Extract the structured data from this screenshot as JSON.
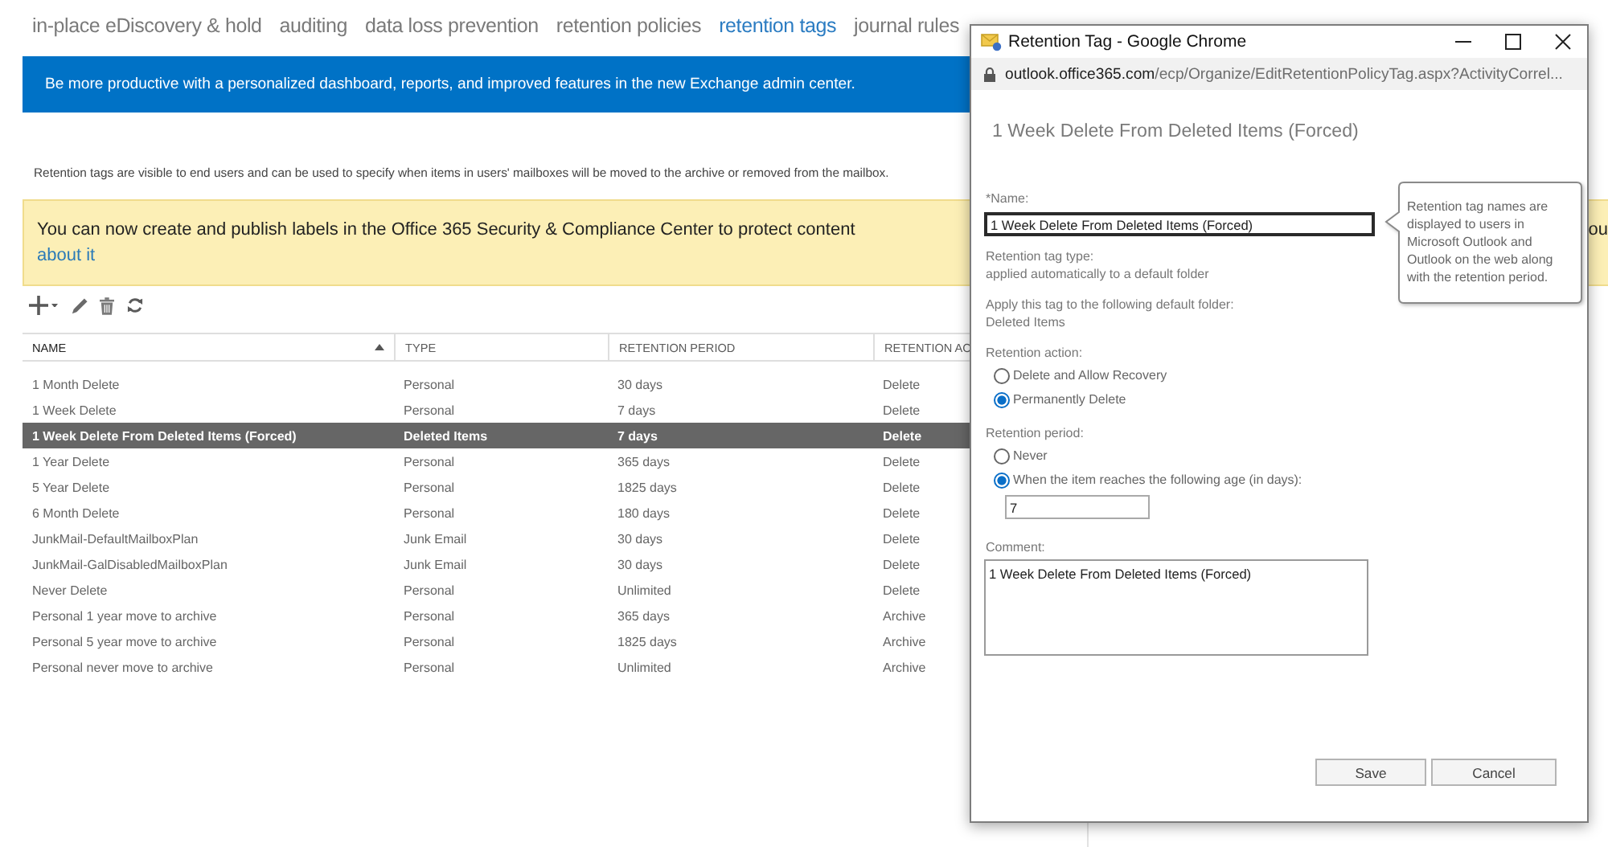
{
  "nav_tabs": [
    {
      "label": "in-place eDiscovery & hold",
      "selected": false
    },
    {
      "label": "auditing",
      "selected": false
    },
    {
      "label": "data loss prevention",
      "selected": false
    },
    {
      "label": "retention policies",
      "selected": false
    },
    {
      "label": "retention tags",
      "selected": true
    },
    {
      "label": "journal rules",
      "selected": false
    }
  ],
  "promo_banner": {
    "text": "Be more productive with a personalized dashboard, reports, and improved features in the new Exchange admin center."
  },
  "description": "Retention tags are visible to end users and can be used to specify when items in users' mailboxes will be moved to the archive or removed from the mailbox.",
  "notice_banner": {
    "text": "You can now create and publish labels in the Office 365 Security & Compliance Center to protect content",
    "text_right_edge": "ou",
    "link": "about it"
  },
  "table": {
    "columns": [
      {
        "label": "NAME",
        "sorted": true
      },
      {
        "label": "TYPE",
        "sorted": false
      },
      {
        "label": "RETENTION PERIOD",
        "sorted": false
      },
      {
        "label": "RETENTION AC",
        "sorted": false
      }
    ],
    "rows": [
      {
        "cells": [
          "1 Month Delete",
          "Personal",
          "30 days",
          "Delete"
        ],
        "selected": false
      },
      {
        "cells": [
          "1 Week Delete",
          "Personal",
          "7 days",
          "Delete"
        ],
        "selected": false
      },
      {
        "cells": [
          "1 Week Delete From Deleted Items (Forced)",
          "Deleted Items",
          "7 days",
          "Delete"
        ],
        "selected": true
      },
      {
        "cells": [
          "1 Year Delete",
          "Personal",
          "365 days",
          "Delete"
        ],
        "selected": false
      },
      {
        "cells": [
          "5 Year Delete",
          "Personal",
          "1825 days",
          "Delete"
        ],
        "selected": false
      },
      {
        "cells": [
          "6 Month Delete",
          "Personal",
          "180 days",
          "Delete"
        ],
        "selected": false
      },
      {
        "cells": [
          "JunkMail-DefaultMailboxPlan",
          "Junk Email",
          "30 days",
          "Delete"
        ],
        "selected": false
      },
      {
        "cells": [
          "JunkMail-GalDisabledMailboxPlan",
          "Junk Email",
          "30 days",
          "Delete"
        ],
        "selected": false
      },
      {
        "cells": [
          "Never Delete",
          "Personal",
          "Unlimited",
          "Delete"
        ],
        "selected": false
      },
      {
        "cells": [
          "Personal 1 year move to archive",
          "Personal",
          "365 days",
          "Archive"
        ],
        "selected": false
      },
      {
        "cells": [
          "Personal 5 year move to archive",
          "Personal",
          "1825 days",
          "Archive"
        ],
        "selected": false
      },
      {
        "cells": [
          "Personal never move to archive",
          "Personal",
          "Unlimited",
          "Archive"
        ],
        "selected": false
      }
    ]
  },
  "dialog": {
    "window_title": "Retention Tag - Google Chrome",
    "address_bar": {
      "host": "outlook.office365.com",
      "path": "/ecp/Organize/EditRetentionPolicyTag.aspx?ActivityCorrel..."
    },
    "heading": "1 Week Delete From Deleted Items (Forced)",
    "name_field": {
      "label": "*Name:",
      "value": "1 Week Delete From Deleted Items (Forced)",
      "focused": true
    },
    "tooltip": "Retention tag names are displayed to users in Microsoft Outlook and Outlook on the web along with the retention period.",
    "tag_type": {
      "label": "Retention tag type:",
      "value": "applied automatically to a default folder"
    },
    "folder": {
      "label": "Apply this tag to the following default folder:",
      "value": "Deleted Items"
    },
    "retention_action": {
      "label": "Retention action:",
      "options": [
        {
          "label": "Delete and Allow Recovery",
          "selected": false
        },
        {
          "label": "Permanently Delete",
          "selected": true
        }
      ]
    },
    "retention_period": {
      "label": "Retention period:",
      "options": [
        {
          "label": "Never",
          "selected": false
        },
        {
          "label": "When the item reaches the following age (in days):",
          "selected": true
        }
      ],
      "days_field": {
        "value": "7"
      }
    },
    "comment": {
      "label": "Comment:",
      "value": "1 Week Delete From Deleted Items (Forced)"
    },
    "buttons": [
      {
        "label": "Save"
      },
      {
        "label": "Cancel"
      }
    ]
  }
}
